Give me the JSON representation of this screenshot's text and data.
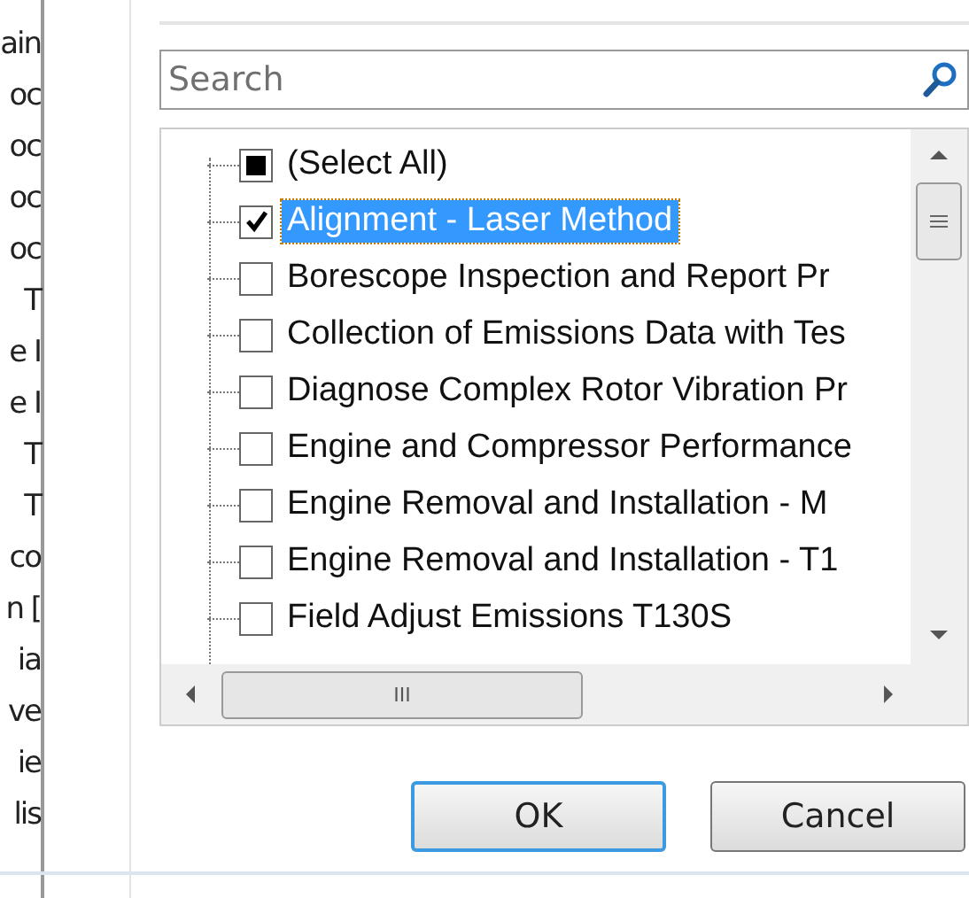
{
  "background_column": [
    "ain",
    "oc",
    "oc",
    "oc",
    "oc",
    "T",
    "e I",
    "e I",
    "T",
    "T",
    "co",
    "n [",
    "ia",
    "ve",
    "ie",
    "lis"
  ],
  "search": {
    "placeholder": "Search"
  },
  "items": [
    {
      "kind": "select-all",
      "label": "(Select All)",
      "partial": true,
      "selected": false
    },
    {
      "kind": "value",
      "label": "Alignment - Laser Method",
      "checked": true,
      "selected": true
    },
    {
      "kind": "value",
      "label": "Borescope Inspection and Report Pr",
      "checked": false,
      "selected": false
    },
    {
      "kind": "value",
      "label": "Collection of Emissions Data with Tes",
      "checked": false,
      "selected": false
    },
    {
      "kind": "value",
      "label": "Diagnose Complex Rotor Vibration Pr",
      "checked": false,
      "selected": false
    },
    {
      "kind": "value",
      "label": "Engine and Compressor Performance",
      "checked": false,
      "selected": false
    },
    {
      "kind": "value",
      "label": "Engine Removal and Installation - M",
      "checked": false,
      "selected": false
    },
    {
      "kind": "value",
      "label": "Engine Removal and Installation - T1",
      "checked": false,
      "selected": false
    },
    {
      "kind": "value",
      "label": "Field Adjust Emissions T130S",
      "checked": false,
      "selected": false
    }
  ],
  "scroll_glyph": "III",
  "buttons": [
    {
      "label": "OK",
      "default": true
    },
    {
      "label": "Cancel",
      "default": false
    }
  ]
}
